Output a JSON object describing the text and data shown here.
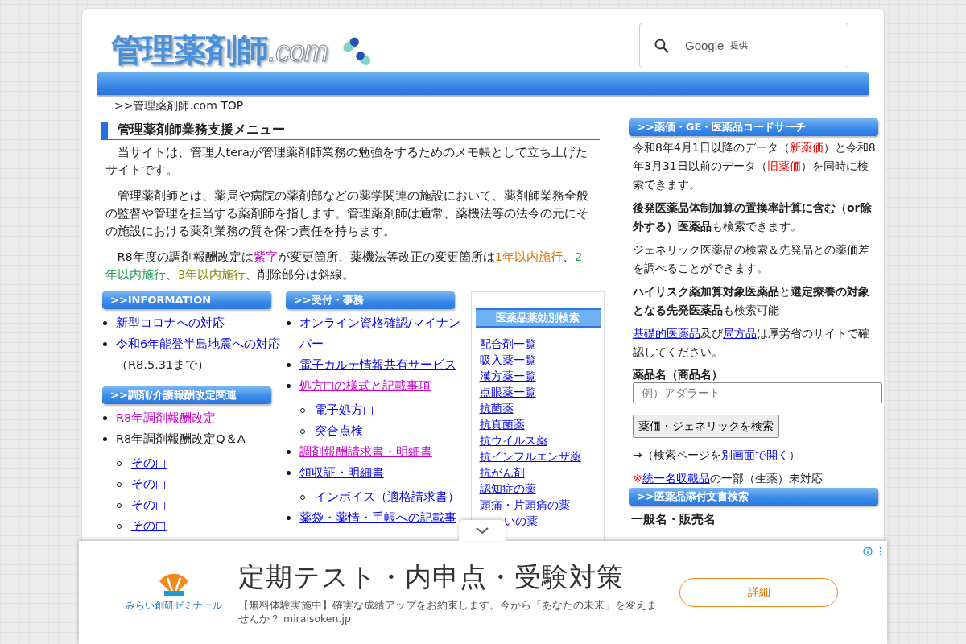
{
  "logo": {
    "text": "管理薬剤師",
    "suffix": ".com"
  },
  "search": {
    "brand": "Google",
    "note": "提供"
  },
  "breadcrumb": ">>管理薬剤師.com TOP",
  "menu": {
    "title": "管理薬剤師業務支援メニュー",
    "paragraphs": [
      [
        {
          "kind": "text",
          "text": "当サイトは、管理人teraが管理薬剤師業務の勉強をするためのメモ帳として立ち上げたサイトです。"
        }
      ],
      [
        {
          "kind": "text",
          "text": "管理薬剤師とは、薬局や病院の薬剤部などの薬学関連の施設において、薬剤師業務全般の監督や管理を担当する薬剤師を指します。管理薬剤師は通常、薬機法等の法令の元にその施設における薬剤業務の質を保つ責任を持ちます。"
        }
      ],
      [
        {
          "kind": "text",
          "text": "R8年度の調剤報酬改定は"
        },
        {
          "kind": "colored",
          "text": "紫字",
          "color": "#cc00cc"
        },
        {
          "kind": "text",
          "text": "が変更箇所、薬機法等改正の変更箇所は"
        },
        {
          "kind": "colored",
          "text": "1年以内施行",
          "color": "#e07000"
        },
        {
          "kind": "text",
          "text": "、"
        },
        {
          "kind": "colored",
          "text": "2年以内施行",
          "color": "#20a050"
        },
        {
          "kind": "text",
          "text": "、"
        },
        {
          "kind": "colored",
          "text": "3年以内施行",
          "color": "#8a8a00"
        },
        {
          "kind": "text",
          "text": "、削除部分は斜線。"
        }
      ]
    ]
  },
  "left_sections": [
    {
      "title": ">>INFORMATION",
      "items": [
        {
          "kind": "link",
          "text": "新型コロナへの対応",
          "color": "#0000ee"
        },
        {
          "kind": "link",
          "text": "令和6年能登半島地震への対応",
          "color": "#0000ee",
          "note": "（R8.5.31まで）"
        }
      ]
    },
    {
      "title": ">>調剤/介護報酬改定関連",
      "items": [
        {
          "kind": "link",
          "text": "R8年調剤報酬改定",
          "color": "#cc00cc"
        },
        {
          "kind": "text",
          "text": "R8年調剤報酬改定Q＆A",
          "children": [
            {
              "kind": "link",
              "text": "その□",
              "color": "#0000ee"
            },
            {
              "kind": "link",
              "text": "その□",
              "color": "#0000ee"
            },
            {
              "kind": "link",
              "text": "その□",
              "color": "#0000ee"
            },
            {
              "kind": "link",
              "text": "その□",
              "color": "#0000ee"
            }
          ]
        }
      ]
    }
  ],
  "middle_sections": [
    {
      "title": ">>受付・事務",
      "items": [
        {
          "kind": "link",
          "text": "オンライン資格確認/マイナンバー",
          "color": "#0000ee"
        },
        {
          "kind": "link",
          "text": "電子カルテ情報共有サービス",
          "color": "#0000ee"
        },
        {
          "kind": "link",
          "text": "処方□の様式と記載事項",
          "color": "#cc00cc",
          "children": [
            {
              "kind": "link",
              "text": "電子処方□",
              "color": "#0000ee"
            },
            {
              "kind": "link",
              "text": "突合点検",
              "color": "#0000ee"
            }
          ]
        },
        {
          "kind": "link",
          "text": "調剤報酬請求書・明細書",
          "color": "#cc00cc"
        },
        {
          "kind": "link",
          "text": "領収証・明細書",
          "color": "#0000ee",
          "children": [
            {
              "kind": "link",
              "text": "インボイス（適格請求書）",
              "color": "#0000ee"
            }
          ]
        },
        {
          "kind": "link",
          "text": "薬袋・薬情・手帳への記載事",
          "color": "#0000ee"
        }
      ]
    }
  ],
  "efficacy": {
    "title": "医薬品薬効別検索",
    "links": [
      {
        "kind": "link",
        "text": "配合剤一覧"
      },
      {
        "kind": "link",
        "text": "吸入薬一覧"
      },
      {
        "kind": "link",
        "text": "漢方薬一覧"
      },
      {
        "kind": "link",
        "text": "点眼薬一覧"
      },
      {
        "kind": "link",
        "text": "抗菌薬"
      },
      {
        "kind": "link",
        "text": "抗真菌薬"
      },
      {
        "kind": "link",
        "text": "抗ウイルス薬"
      },
      {
        "kind": "link",
        "text": "抗インフルエンザ薬"
      },
      {
        "kind": "link",
        "text": "抗がん剤"
      },
      {
        "kind": "link",
        "text": "認知症の薬"
      },
      {
        "kind": "link",
        "text": "頭痛・片頭痛の薬"
      },
      {
        "kind": "covered",
        "text": "いの薬"
      }
    ]
  },
  "side": {
    "title": ">>薬価・GE・医薬品コードサーチ",
    "paragraphs": [
      [
        {
          "kind": "text",
          "text": "令和8年4月1日以降のデータ（"
        },
        {
          "kind": "colored",
          "text": "新薬価",
          "color": "#ee0000"
        },
        {
          "kind": "text",
          "text": "）と令和8年3月31日以前のデータ（"
        },
        {
          "kind": "colored",
          "text": "旧薬価",
          "color": "#ee0000"
        },
        {
          "kind": "text",
          "text": "）を同時に検索できます。"
        }
      ],
      [
        {
          "kind": "bold",
          "text": "後発医薬品体制加算の置換率計算に含む（or除外する）医薬品"
        },
        {
          "kind": "text",
          "text": "も検索できます。"
        }
      ],
      [
        {
          "kind": "text",
          "text": "ジェネリック医薬品の検索＆先発品との薬価差を調べることができます。"
        }
      ],
      [
        {
          "kind": "bold",
          "text": "ハイリスク薬加算対象医薬品"
        },
        {
          "kind": "text",
          "text": "と"
        },
        {
          "kind": "bold",
          "text": "選定療養の対象となる先発医薬品"
        },
        {
          "kind": "text",
          "text": "も検索可能"
        }
      ],
      [
        {
          "kind": "link",
          "text": "基礎的医薬品",
          "color": "#0000ee"
        },
        {
          "kind": "text",
          "text": "及び"
        },
        {
          "kind": "link",
          "text": "局方品",
          "color": "#0000ee"
        },
        {
          "kind": "text",
          "text": "は厚労省のサイトで確認してください。"
        }
      ]
    ],
    "field_label": "薬品名（商品名）",
    "placeholder": "例）アダラート",
    "button": "薬価・ジェネリックを検索",
    "open_line": [
      {
        "kind": "text",
        "text": "→（検索ページを"
      },
      {
        "kind": "link",
        "text": "別画面で開く",
        "color": "#0000ee"
      },
      {
        "kind": "text",
        "text": "）"
      }
    ],
    "note_line": [
      {
        "kind": "colored",
        "text": "※",
        "color": "#ee0000"
      },
      {
        "kind": "link",
        "text": "統一名収載品",
        "color": "#0000ee"
      },
      {
        "kind": "text",
        "text": "の一部（生薬）未対応"
      }
    ],
    "title2": ">>医薬品添付文書検索",
    "field_label2": "一般名・販売名"
  },
  "ad": {
    "logo_text": "みらい創研ゼミナール",
    "headline": "定期テスト・内申点・受験対策",
    "description": "【無料体験実施中】確実な成績アップをお約束します。今から「あなたの未来」を変えませんか？ miraisoken.jp",
    "button": "詳細"
  }
}
